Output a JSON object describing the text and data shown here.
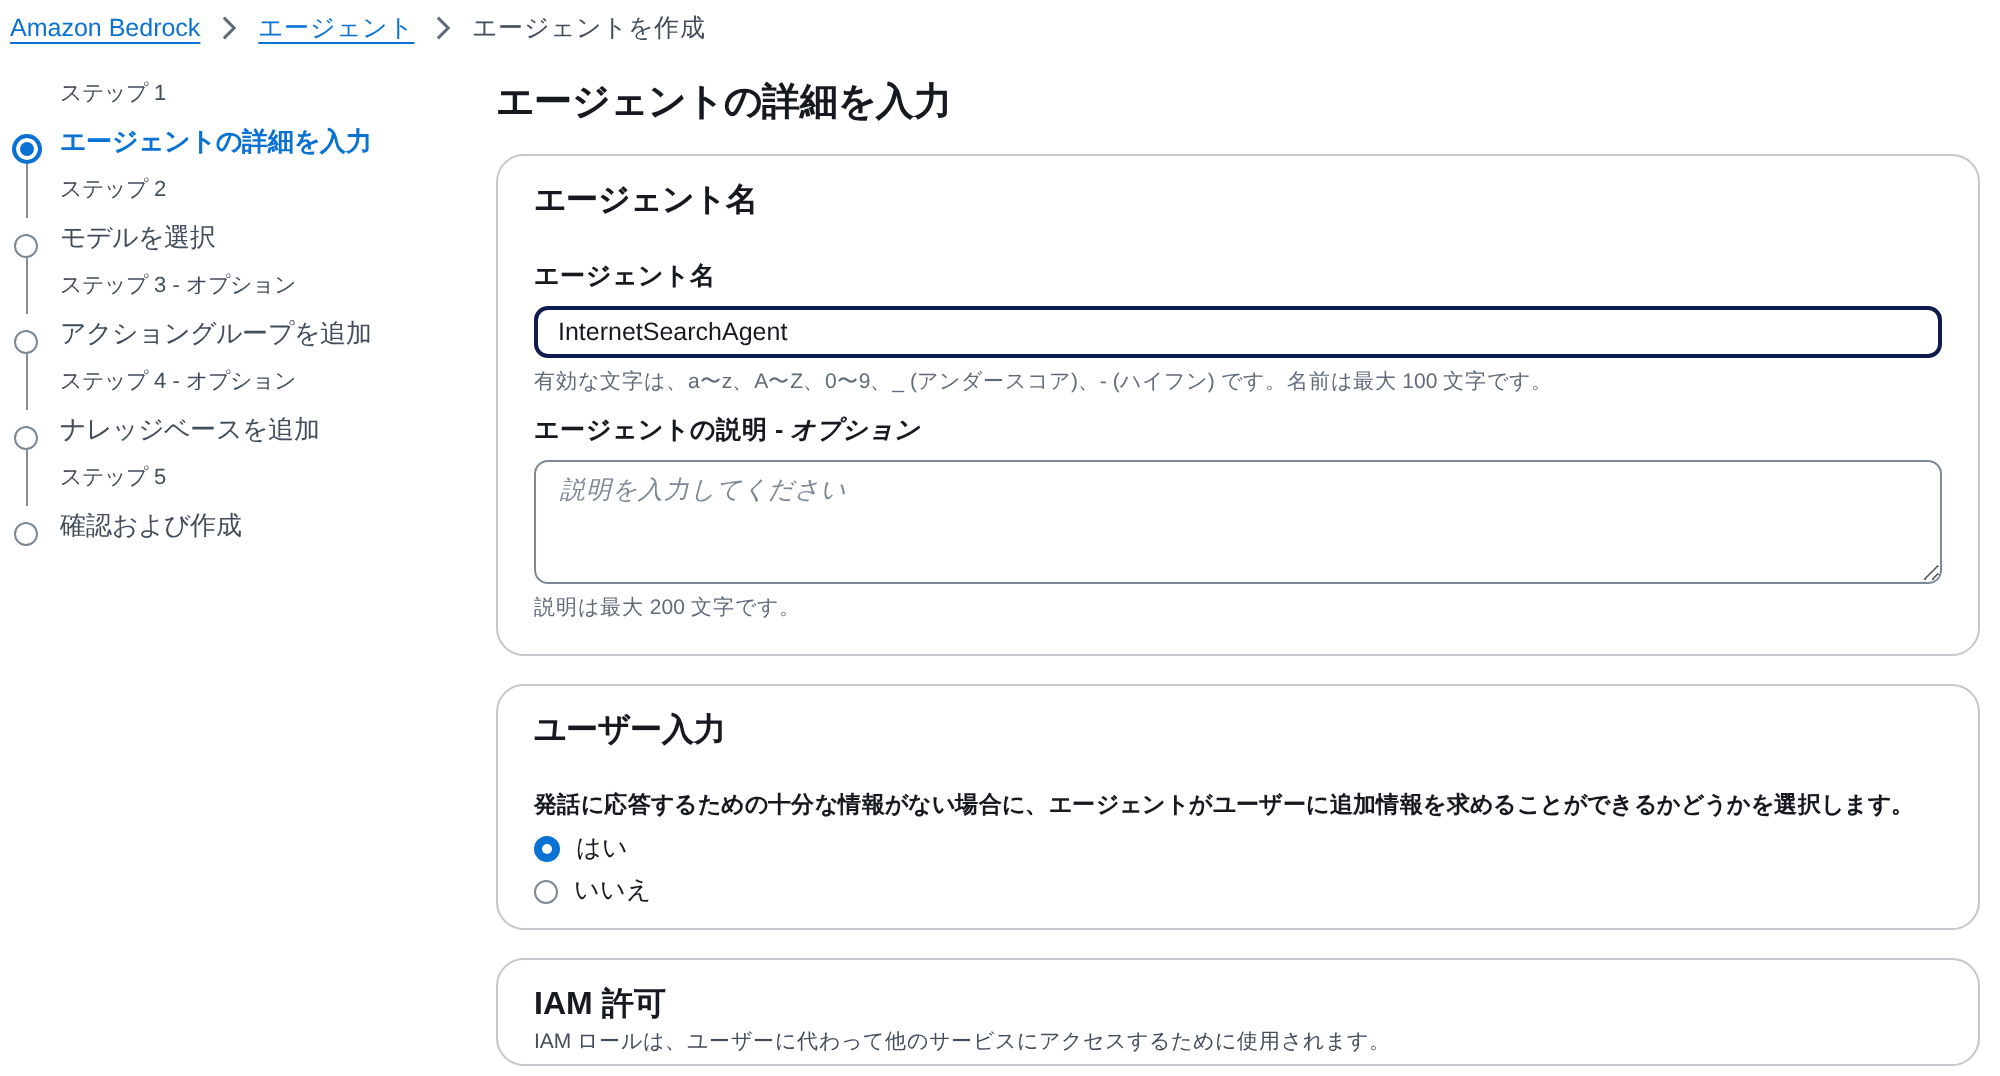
{
  "breadcrumbs": [
    {
      "label": "Amazon Bedrock",
      "kind": "link"
    },
    {
      "label": "エージェント",
      "kind": "link"
    },
    {
      "label": "エージェントを作成",
      "kind": "current"
    }
  ],
  "steps": [
    {
      "label": "ステップ 1",
      "title": "エージェントの詳細を入力",
      "selected": true
    },
    {
      "label": "ステップ 2",
      "title": "モデルを選択",
      "selected": false
    },
    {
      "label": "ステップ 3 - オプション",
      "title": "アクショングループを追加",
      "selected": false
    },
    {
      "label": "ステップ 4 - オプション",
      "title": "ナレッジベースを追加",
      "selected": false
    },
    {
      "label": "ステップ 5",
      "title": "確認および作成",
      "selected": false
    }
  ],
  "page_title": "エージェントの詳細を入力",
  "agent_name_card": {
    "title": "エージェント名",
    "name_field": {
      "label": "エージェント名",
      "value": "InternetSearchAgent",
      "hint": "有効な文字は、a〜z、A〜Z、0〜9、_ (アンダースコア)、- (ハイフン) です。名前は最大 100 文字です。"
    },
    "description_field": {
      "label": "エージェントの説明 - *オプション*",
      "placeholder": "説明を入力してください",
      "hint": "説明は最大 200 文字です。"
    }
  },
  "user_input_card": {
    "title": "ユーザー入力",
    "question": "発話に応答するための十分な情報がない場合に、エージェントがユーザーに追加情報を求めることができるかどうかを選択します。",
    "options": [
      {
        "label": "はい",
        "selected": true
      },
      {
        "label": "いいえ",
        "selected": false
      }
    ]
  },
  "iam_card": {
    "title": "IAM 許可",
    "description": "IAM ロールは、ユーザーに代わって他のサービスにアクセスするために使用されます。"
  }
}
